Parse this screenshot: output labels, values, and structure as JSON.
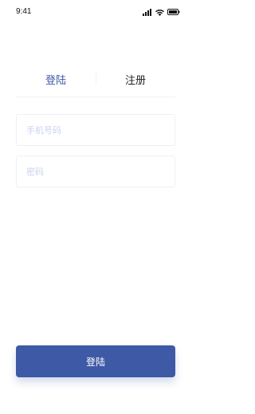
{
  "status_bar": {
    "time": "9:41",
    "icons": [
      "cellular-signal-icon",
      "wifi-icon",
      "battery-icon"
    ]
  },
  "tabs": {
    "login_label": "登陆",
    "register_label": "注册",
    "active": "login"
  },
  "form": {
    "phone_placeholder": "手机号码",
    "phone_value": "",
    "password_placeholder": "密码",
    "password_value": ""
  },
  "login_button_label": "登陆",
  "colors": {
    "accent": "#3e59a5",
    "placeholder": "#c9d3ea",
    "text_dark": "#222222"
  }
}
